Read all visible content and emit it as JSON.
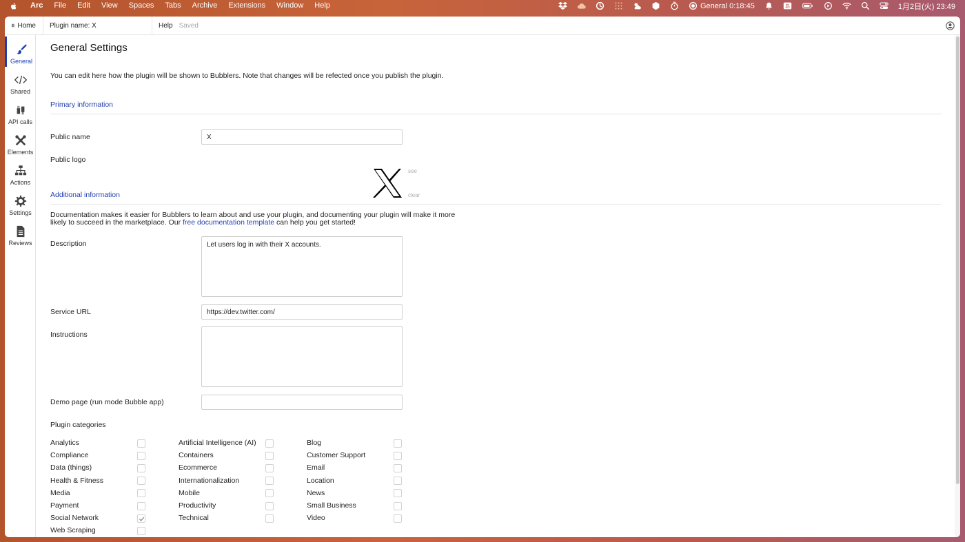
{
  "menubar": {
    "app": "Arc",
    "menus": [
      "File",
      "Edit",
      "View",
      "Spaces",
      "Tabs",
      "Archive",
      "Extensions",
      "Window",
      "Help"
    ],
    "recording": "General 0:18:45",
    "clock": "1月2日(火) 23:49"
  },
  "topbar": {
    "home": "Home",
    "plugin_name": "Plugin name: X",
    "help": "Help",
    "saved": "Saved"
  },
  "sidebar": {
    "items": [
      {
        "label": "General",
        "icon": "brush-icon",
        "active": true
      },
      {
        "label": "Shared",
        "icon": "code-icon"
      },
      {
        "label": "API calls",
        "icon": "plug-icon"
      },
      {
        "label": "Elements",
        "icon": "tools-icon"
      },
      {
        "label": "Actions",
        "icon": "sitemap-icon"
      },
      {
        "label": "Settings",
        "icon": "gear-icon"
      },
      {
        "label": "Reviews",
        "icon": "document-icon"
      }
    ]
  },
  "page": {
    "title": "General Settings",
    "intro": "You can edit here how the plugin will be shown to Bubblers. Note that changes will be refected once you publish the plugin.",
    "primary_title": "Primary information",
    "public_name_label": "Public name",
    "public_name_value": "X",
    "public_logo_label": "Public logo",
    "logo_see": "see",
    "logo_clear": "clear",
    "additional_title": "Additional information",
    "doc_text_1": "Documentation makes it easier for Bubblers to learn about and use your plugin, and documenting your plugin will make it more likely to succeed in the marketplace. Our ",
    "doc_link": "free documentation template",
    "doc_text_2": " can help you get started!",
    "description_label": "Description",
    "description_value": "Let users log in with their X accounts.",
    "service_url_label": "Service URL",
    "service_url_value": "https://dev.twitter.com/",
    "instructions_label": "Instructions",
    "instructions_value": "",
    "demo_label": "Demo page (run mode Bubble app)",
    "demo_value": "",
    "categories_title": "Plugin categories"
  },
  "categories": [
    {
      "label": "Analytics",
      "checked": false
    },
    {
      "label": "Artificial Intelligence (AI)",
      "checked": false
    },
    {
      "label": "Blog",
      "checked": false
    },
    {
      "label": "Compliance",
      "checked": false
    },
    {
      "label": "Containers",
      "checked": false
    },
    {
      "label": "Customer Support",
      "checked": false
    },
    {
      "label": "Data (things)",
      "checked": false
    },
    {
      "label": "Ecommerce",
      "checked": false
    },
    {
      "label": "Email",
      "checked": false
    },
    {
      "label": "Health & Fitness",
      "checked": false
    },
    {
      "label": "Internationalization",
      "checked": false
    },
    {
      "label": "Location",
      "checked": false
    },
    {
      "label": "Media",
      "checked": false
    },
    {
      "label": "Mobile",
      "checked": false
    },
    {
      "label": "News",
      "checked": false
    },
    {
      "label": "Payment",
      "checked": false
    },
    {
      "label": "Productivity",
      "checked": false
    },
    {
      "label": "Small Business",
      "checked": false
    },
    {
      "label": "Social Network",
      "checked": true
    },
    {
      "label": "Technical",
      "checked": false
    },
    {
      "label": "Video",
      "checked": false
    },
    {
      "label": "Web Scraping",
      "checked": false
    }
  ],
  "colors": {
    "accent": "#2541b2",
    "active_nav": "#1a3fb5"
  }
}
